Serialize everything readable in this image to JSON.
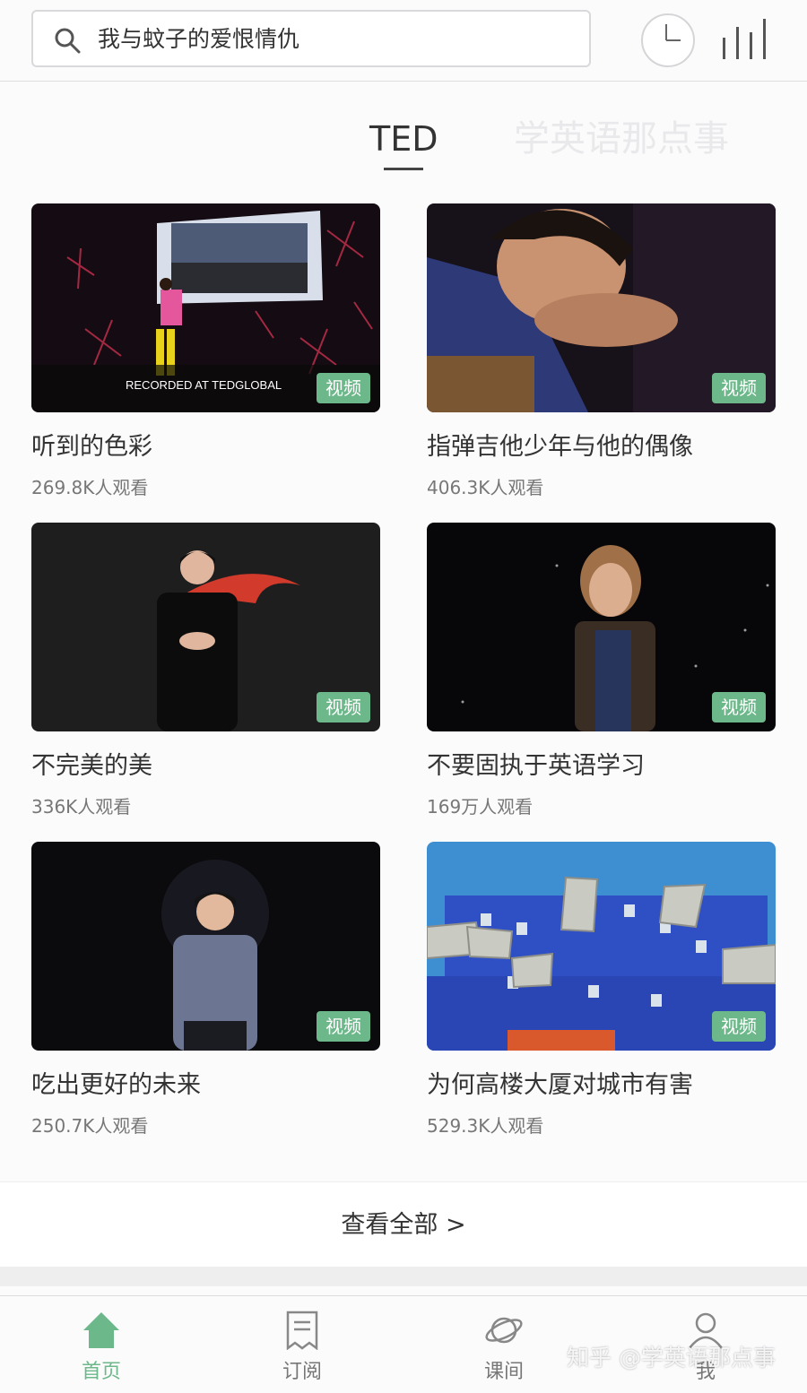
{
  "colors": {
    "accent": "#6db88a",
    "text": "#333333",
    "subtext": "#777777",
    "inactive_tab": "#e9e9eb"
  },
  "header": {
    "search_text": "我与蚊子的爱恨情仇",
    "icons": [
      "search-icon",
      "history-clock-icon",
      "bar-chart-icon"
    ]
  },
  "tabs": [
    {
      "label": "TED",
      "active": true
    },
    {
      "label": "学英语那点事",
      "active": false
    }
  ],
  "videos": [
    {
      "title": "听到的色彩",
      "views": "269.8K人观看",
      "badge": "视频",
      "overlay": "RECORDED AT TEDGLOBAL"
    },
    {
      "title": "指弹吉他少年与他的偶像",
      "views": "406.3K人观看",
      "badge": "视频"
    },
    {
      "title": "不完美的美",
      "views": "336K人观看",
      "badge": "视频"
    },
    {
      "title": "不要固执于英语学习",
      "views": "169万人观看",
      "badge": "视频"
    },
    {
      "title": "吃出更好的未来",
      "views": "250.7K人观看",
      "badge": "视频"
    },
    {
      "title": "为何高楼大厦对城市有害",
      "views": "529.3K人观看",
      "badge": "视频"
    }
  ],
  "view_all": "查看全部 >",
  "bottom_nav": [
    {
      "label": "首页",
      "icon": "home-icon",
      "active": true
    },
    {
      "label": "订阅",
      "icon": "document-icon",
      "active": false
    },
    {
      "label": "课间",
      "icon": "planet-icon",
      "active": false
    },
    {
      "label": "我",
      "icon": "person-icon",
      "active": false
    }
  ],
  "watermark": "知乎 @学英语那点事"
}
